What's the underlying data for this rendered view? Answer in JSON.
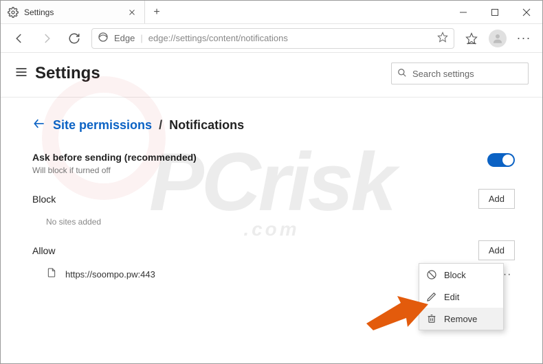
{
  "titlebar": {
    "tab_title": "Settings",
    "tab_favicon": "gear-icon",
    "newtab_glyph": "+"
  },
  "address": {
    "back_available": true,
    "forward_available": false,
    "prefix_icon": "edge-logo",
    "prefix_label": "Edge",
    "url": "edge://settings/content/notifications"
  },
  "search": {
    "placeholder": "Search settings",
    "icon": "search-icon"
  },
  "header": {
    "settings_label": "Settings"
  },
  "breadcrumb": {
    "back_icon": "arrow-left-icon",
    "parent": "Site permissions",
    "sep": "/",
    "current": "Notifications"
  },
  "ask_before": {
    "label": "Ask before sending (recommended)",
    "sub": "Will block if turned off",
    "toggle_on": true
  },
  "block_section": {
    "label": "Block",
    "add_label": "Add",
    "empty_text": "No sites added",
    "sites": []
  },
  "allow_section": {
    "label": "Allow",
    "add_label": "Add",
    "sites": [
      {
        "icon": "file-icon",
        "url": "https://soompo.pw:443"
      }
    ]
  },
  "context_menu": {
    "items": [
      {
        "icon": "block-icon",
        "label": "Block",
        "hover": false
      },
      {
        "icon": "pencil-icon",
        "label": "Edit",
        "hover": false
      },
      {
        "icon": "trash-icon",
        "label": "Remove",
        "hover": true
      }
    ]
  },
  "annotation": {
    "arrow_color": "#e35b0c"
  },
  "watermark": {
    "main": "PCrisk",
    "sub": ".com"
  }
}
